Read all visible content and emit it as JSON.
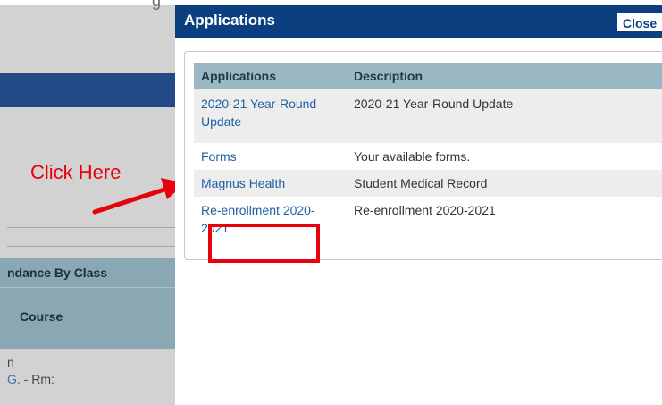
{
  "background": {
    "top_partial_text": "g",
    "attendance_header": "ndance By Class",
    "course_header": "Course",
    "row_text_n": "n",
    "row_link": "G.",
    "row_suffix": " - Rm:"
  },
  "annotation": {
    "text": "Click Here"
  },
  "dialog": {
    "title": "Applications",
    "close_label": "Close",
    "table": {
      "columns": [
        "Applications",
        "Description"
      ],
      "rows": [
        {
          "app_line1": "2020-21 Year-Round",
          "app_line2": "Update",
          "description": "2020-21 Year-Round Update"
        },
        {
          "app_line1": "Forms",
          "app_line2": "",
          "description": "Your available forms."
        },
        {
          "app_line1": "Magnus Health",
          "app_line2": "",
          "description": "Student Medical Record"
        },
        {
          "app_line1": "Re-enrollment 2020-",
          "app_line2": "2021",
          "description": "Re-enrollment 2020-2021"
        }
      ]
    }
  },
  "colors": {
    "titlebar": "#0c3f80",
    "table_header": "#9ab8c4",
    "link": "#1f5fa6",
    "highlight": "#e8000b"
  }
}
